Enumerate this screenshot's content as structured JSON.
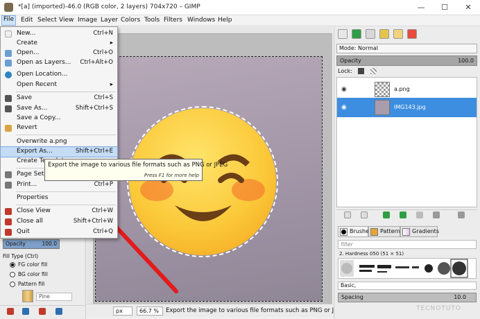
{
  "window": {
    "title": "*[a] (imported)-46.0 (RGB color, 2 layers) 704x720 – GIMP",
    "minimize": "—",
    "maximize": "☐",
    "close": "✕"
  },
  "menubar": {
    "items": [
      "File",
      "Edit",
      "Select",
      "View",
      "Image",
      "Layer",
      "Colors",
      "Tools",
      "Filters",
      "Windows",
      "Help"
    ]
  },
  "file_menu": {
    "items": [
      {
        "label": "New...",
        "shortcut": "Ctrl+N"
      },
      {
        "label": "Create",
        "shortcut": "▸"
      },
      {
        "label": "Open...",
        "shortcut": "Ctrl+O"
      },
      {
        "label": "Open as Layers...",
        "shortcut": "Ctrl+Alt+O"
      },
      {
        "label": "Open Location...",
        "shortcut": ""
      },
      {
        "label": "Open Recent",
        "shortcut": "▸"
      },
      {
        "label": "Save",
        "shortcut": "Ctrl+S"
      },
      {
        "label": "Save As...",
        "shortcut": "Shift+Ctrl+S"
      },
      {
        "label": "Save a Copy...",
        "shortcut": ""
      },
      {
        "label": "Revert",
        "shortcut": ""
      },
      {
        "label": "Overwrite a.png",
        "shortcut": ""
      },
      {
        "label": "Export As...",
        "shortcut": "Shift+Ctrl+E"
      },
      {
        "label": "Create Template...",
        "shortcut": ""
      },
      {
        "label": "Page Setup",
        "shortcut": ""
      },
      {
        "label": "Print...",
        "shortcut": "Ctrl+P"
      },
      {
        "label": "Properties",
        "shortcut": ""
      },
      {
        "label": "Close View",
        "shortcut": "Ctrl+W"
      },
      {
        "label": "Close all",
        "shortcut": "Shift+Ctrl+W"
      },
      {
        "label": "Quit",
        "shortcut": "Ctrl+Q"
      }
    ],
    "highlighted": "Export As..."
  },
  "tooltip": {
    "text": "Export the image to various file formats such as PNG or JPEG",
    "help": "Press F1 for more help"
  },
  "tool_options": {
    "opacity_label": "Opacity",
    "opacity_value": "100.0",
    "fill_type_label": "Fill Type  (Ctrl)",
    "fill_options": [
      "FG color fill",
      "BG color fill",
      "Pattern fill"
    ],
    "selected_fill": "FG color fill",
    "pattern_name": "Pine"
  },
  "status_bar": {
    "unit": "px",
    "zoom": "66.7 %",
    "message": "Export the image to various file formats such as PNG or JPEG"
  },
  "layers_panel": {
    "mode_label": "Mode: Normal",
    "opacity_label": "Opacity",
    "opacity_value": "100.0",
    "lock_label": "Lock:",
    "layers": [
      {
        "name": "a.png",
        "selected": false
      },
      {
        "name": "IMG143.jpg",
        "selected": true
      }
    ]
  },
  "brushes_panel": {
    "tabs": [
      "Brushes",
      "Patterns",
      "Gradients"
    ],
    "filter_placeholder": "filter",
    "brush_name": "2. Hardness 050 (51 × 51)",
    "preset": "Basic,",
    "spacing_label": "Spacing",
    "spacing_value": "10.0"
  },
  "colors": {
    "accent": "#3d8ee0",
    "menu_highlight": "#c5dcf5",
    "emoji_yellow": "#fbc93a"
  }
}
